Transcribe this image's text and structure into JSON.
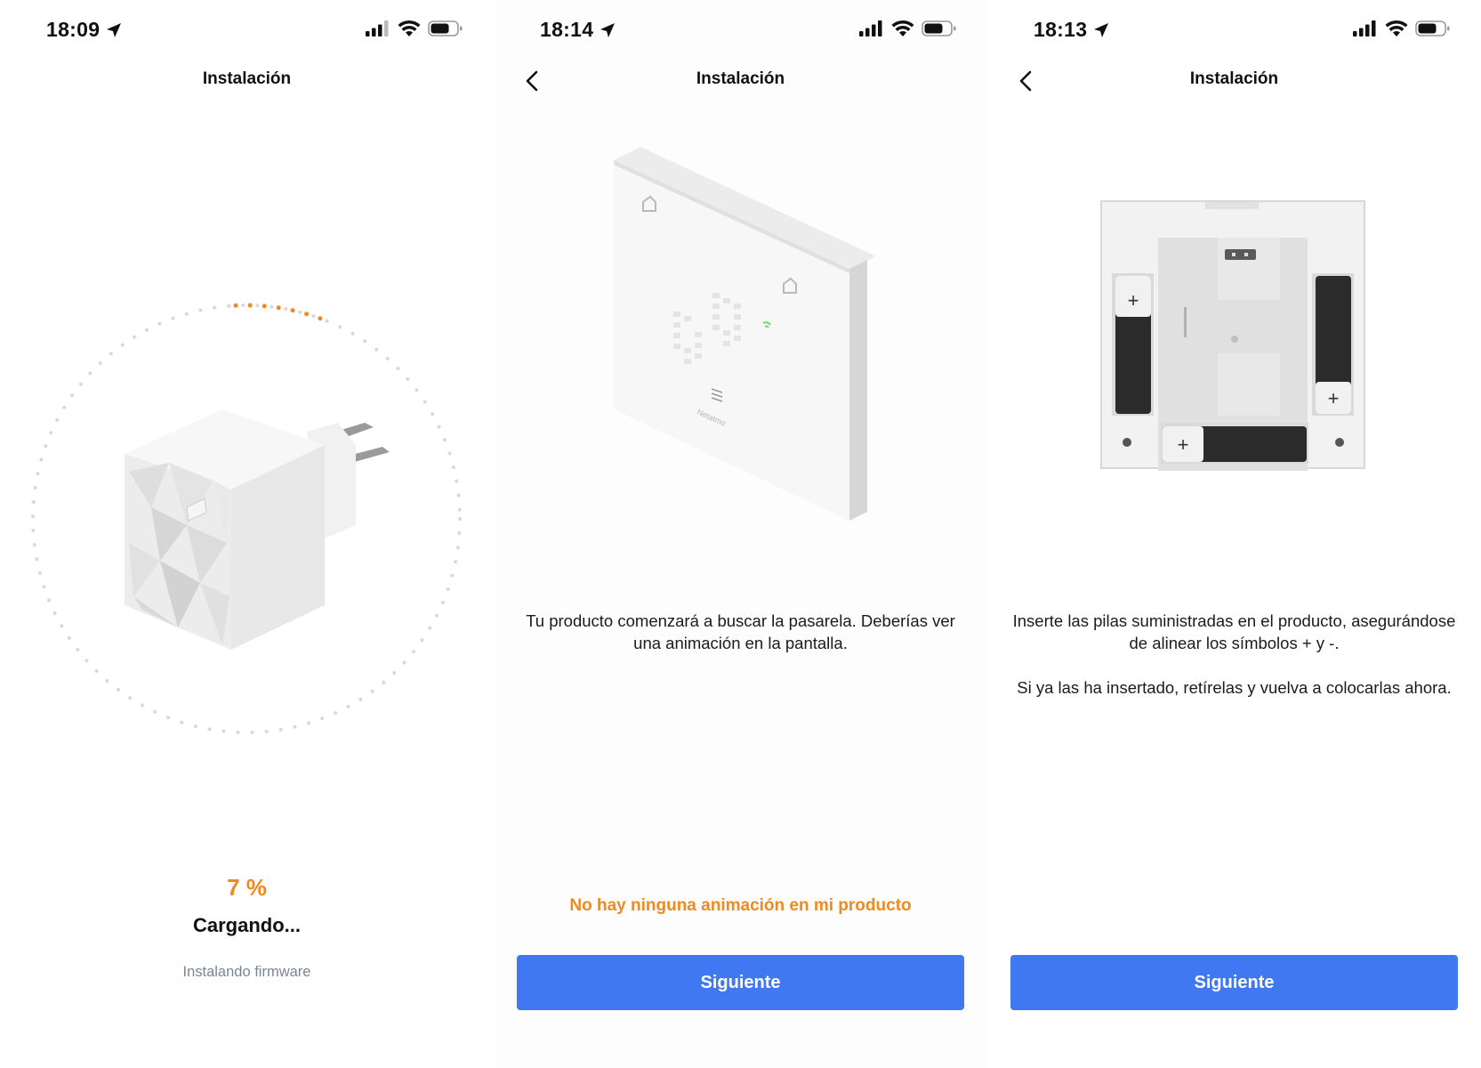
{
  "colors": {
    "accent": "#ee8a1f",
    "primary": "#3f78f0",
    "muted_text": "#7b8592"
  },
  "screens": [
    {
      "status": {
        "time": "18:09"
      },
      "nav": {
        "title": "Instalación"
      },
      "progress": {
        "percent_label": "7 %",
        "value": 0.07
      },
      "loading_title": "Cargando...",
      "loading_subtitle": "Instalando firmware"
    },
    {
      "status": {
        "time": "18:14"
      },
      "nav": {
        "title": "Instalación"
      },
      "device_brand": "Netatmo",
      "description": "Tu producto comenzará a buscar la pasarela. Deberías ver una animación en la pantalla.",
      "link": "No hay ninguna animación en mi producto",
      "button": "Siguiente"
    },
    {
      "status": {
        "time": "18:13"
      },
      "nav": {
        "title": "Instalación"
      },
      "battery_plus_symbol": "+",
      "instruction": "Inserte las pilas suministradas en el producto, asegurándose de alinear los símbolos + y -.",
      "note": "Si ya las ha insertado, retírelas y vuelva a colocarlas ahora.",
      "button": "Siguiente"
    }
  ]
}
